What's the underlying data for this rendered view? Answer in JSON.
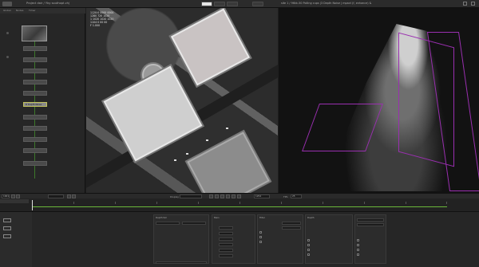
{
  "topbar": {
    "project_title": "Project dair / Yby southopt.chj",
    "view_title": "",
    "right_title": "site 1 / 96kk-50 Polling cups |3 Depth Noise | mpact (f, enhance) &",
    "buttons": [
      "view-single",
      "view-split",
      "view-quad",
      "view-cloud"
    ]
  },
  "left_panel": {
    "tabs": [
      "Global",
      "Nodes",
      "Timer"
    ],
    "nodes": [
      {
        "label": "",
        "selected": false
      },
      {
        "label": "",
        "selected": false
      },
      {
        "label": "",
        "selected": false
      },
      {
        "label": "",
        "selected": false
      },
      {
        "label": "",
        "selected": false
      },
      {
        "label": "D Depth Noise",
        "selected": true
      },
      {
        "label": "",
        "selected": false
      },
      {
        "label": "",
        "selected": false
      },
      {
        "label": "",
        "selected": false
      },
      {
        "label": "",
        "selected": false
      },
      {
        "label": "",
        "selected": false
      }
    ]
  },
  "viewer": {
    "overlay_lines": [
      "1120:0 0000 0000",
      "1280 720 1020",
      "1 1020 1020 1020",
      "1104 0 00 00",
      "F 1.000"
    ]
  },
  "timeline": {
    "frame_start": "1001",
    "frame_end": "1254",
    "display_label": "Display",
    "fps_label": "FPS",
    "fps_value": "25",
    "ticks": [
      "",
      "",
      "",
      "",
      "",
      "",
      "",
      "",
      "",
      "",
      ""
    ]
  },
  "properties": {
    "group1_title": "Depth fall",
    "group2_title": "Main",
    "group3_title": "Filter",
    "group4_title": "Depth"
  },
  "colors": {
    "accent_green": "#6ab83a",
    "frustum_purple": "#9a2fb0",
    "panel_bg": "#262626"
  }
}
